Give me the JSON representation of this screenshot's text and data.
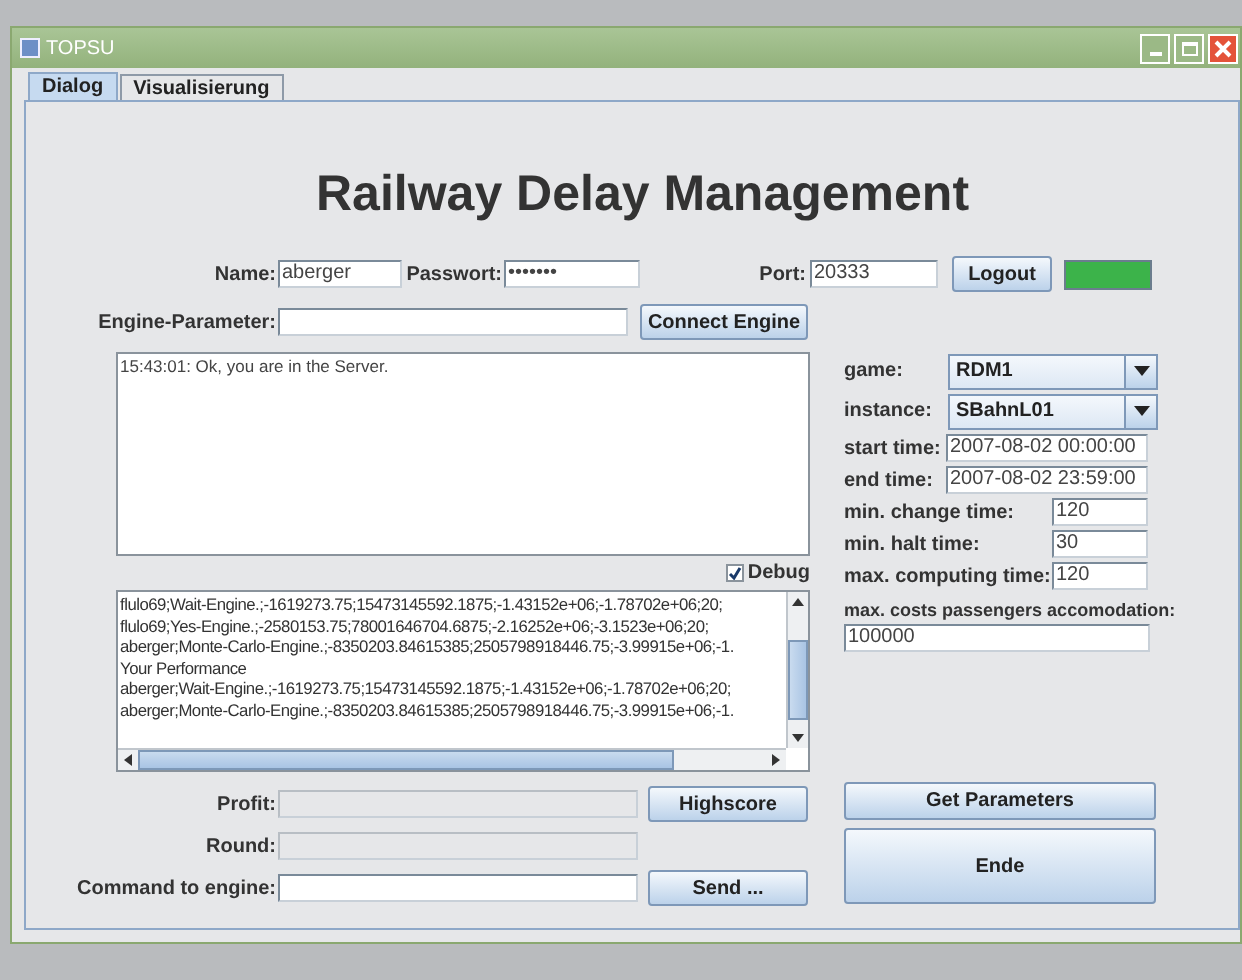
{
  "window": {
    "title": "TOPSU"
  },
  "tabs": [
    {
      "label": "Dialog",
      "selected": true
    },
    {
      "label": "Visualisierung",
      "selected": false
    }
  ],
  "heading": "Railway Delay Management",
  "login": {
    "name_label": "Name:",
    "name_value": "aberger",
    "password_label": "Passwort:",
    "password_value": "•••••••",
    "port_label": "Port:",
    "port_value": "20333",
    "logout_button": "Logout",
    "connected": true
  },
  "engine": {
    "label": "Engine-Parameter:",
    "connect_button": "Connect Engine"
  },
  "log": {
    "lines": [
      "15:43:01: Ok, you are in the Server."
    ]
  },
  "debug": {
    "label": "Debug",
    "checked": true
  },
  "debug_log": {
    "lines": [
      "flulo69;Wait-Engine.;-1619273.75;15473145592.1875;-1.43152e+06;-1.78702e+06;20;",
      "flulo69;Yes-Engine.;-2580153.75;78001646704.6875;-2.16252e+06;-3.1523e+06;20;",
      "aberger;Monte-Carlo-Engine.;-8350203.84615385;2505798918446.75;-3.99915e+06;-1.",
      "Your Performance",
      "aberger;Wait-Engine.;-1619273.75;15473145592.1875;-1.43152e+06;-1.78702e+06;20;",
      "aberger;Monte-Carlo-Engine.;-8350203.84615385;2505798918446.75;-3.99915e+06;-1."
    ]
  },
  "profit": {
    "label": "Profit:",
    "button": "Highscore"
  },
  "round": {
    "label": "Round:"
  },
  "command": {
    "label": "Command to engine:",
    "button": "Send ..."
  },
  "parameters": [
    {
      "kind": "combo",
      "label": "game:",
      "value": "RDM1"
    },
    {
      "kind": "combo",
      "label": "instance:",
      "value": "SBahnL01"
    },
    {
      "kind": "field",
      "label": "start time:",
      "value": "2007-08-02 00:00:00"
    },
    {
      "kind": "field",
      "label": "end time:",
      "value": "2007-08-02 23:59:00"
    },
    {
      "kind": "short",
      "label": "min. change time:",
      "value": "120"
    },
    {
      "kind": "short",
      "label": "min. halt time:",
      "value": "30"
    },
    {
      "kind": "short",
      "label": "max. computing time:",
      "value": "120"
    },
    {
      "kind": "stacked",
      "label": "max. costs passengers accomodation:",
      "value": "100000"
    }
  ],
  "get_parameters_button": "Get Parameters",
  "end_button": "Ende"
}
